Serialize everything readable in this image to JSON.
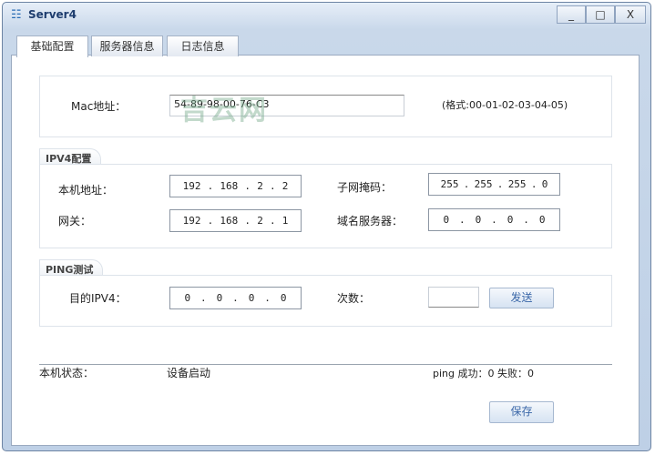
{
  "window": {
    "title": "Server4",
    "minimize": "_",
    "maximize": "□",
    "close": "X"
  },
  "tabs": [
    {
      "label": "基础配置",
      "active": true
    },
    {
      "label": "服务器信息"
    },
    {
      "label": "日志信息"
    }
  ],
  "mac": {
    "label": "Mac地址：",
    "value": "54-89-98-00-76-C3",
    "hint": "(格式:00-01-02-03-04-05)"
  },
  "ipv4": {
    "group": "IPV4配置",
    "ip_label": "本机地址：",
    "ip": [
      "192",
      "168",
      "2",
      "2"
    ],
    "mask_label": "子网掩码：",
    "mask": [
      "255",
      "255",
      "255",
      "0"
    ],
    "gw_label": "网关：",
    "gw": [
      "192",
      "168",
      "2",
      "1"
    ],
    "dns_label": "域名服务器：",
    "dns": [
      "0",
      "0",
      "0",
      "0"
    ]
  },
  "ping": {
    "group": "PING测试",
    "dest_label": "目的IPV4：",
    "dest": [
      "0",
      "0",
      "0",
      "0"
    ],
    "count_label": "次数：",
    "count": "",
    "send": "发送"
  },
  "status": {
    "label": "本机状态：",
    "value": "设备启动",
    "ping_result": "ping 成功：0 失败：0"
  },
  "save": "保存",
  "watermark": "吉云网"
}
